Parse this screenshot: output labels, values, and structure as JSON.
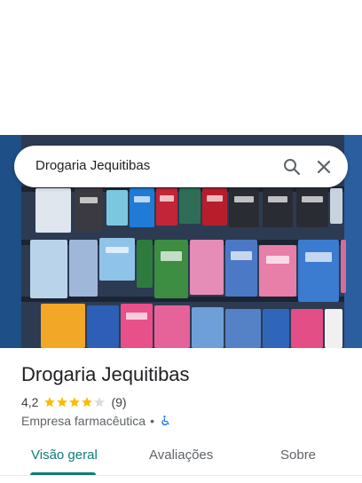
{
  "search": {
    "query": "Drogaria Jequitibas"
  },
  "place": {
    "name": "Drogaria Jequitibas",
    "rating_value": "4,2",
    "rating_stars": 4.2,
    "review_count": "(9)",
    "category": "Empresa farmacêutica",
    "separator": "•"
  },
  "tabs": [
    {
      "label": "Visão geral",
      "active": true
    },
    {
      "label": "Avaliações",
      "active": false
    },
    {
      "label": "Sobre",
      "active": false
    }
  ],
  "colors": {
    "accent": "#0f7b76",
    "star": "#fbbc04",
    "star_empty": "#dadce0",
    "accessibility": "#1a73e8"
  },
  "icons": {
    "search": "search-icon",
    "close": "close-icon",
    "accessible": "wheelchair-icon"
  }
}
